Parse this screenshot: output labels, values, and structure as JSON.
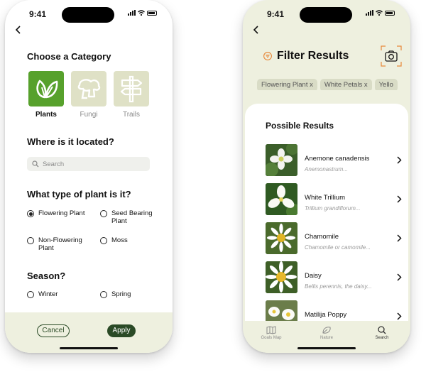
{
  "status": {
    "time": "9:41"
  },
  "screen1": {
    "category_heading": "Choose a Category",
    "categories": [
      {
        "label": "Plants",
        "icon": "leaf-icon",
        "selected": true
      },
      {
        "label": "Fungi",
        "icon": "mushroom-icon",
        "selected": false
      },
      {
        "label": "Trails",
        "icon": "signpost-icon",
        "selected": false
      }
    ],
    "location_heading": "Where is it located?",
    "search_placeholder": "Search",
    "plant_type_heading": "What type of plant is it?",
    "plant_types": [
      {
        "label": "Flowering Plant",
        "selected": true
      },
      {
        "label": "Seed Bearing Plant",
        "selected": false
      },
      {
        "label": "Non-Flowering Plant",
        "selected": false
      },
      {
        "label": "Moss",
        "selected": false
      }
    ],
    "season_heading": "Season?",
    "seasons": [
      {
        "label": "Winter",
        "selected": false
      },
      {
        "label": "Spring",
        "selected": false
      }
    ],
    "cancel_label": "Cancel",
    "apply_label": "Apply"
  },
  "screen2": {
    "title": "Filter Results",
    "chips": [
      "Flowering Plant x",
      "White Petals x",
      "Yello"
    ],
    "results_heading": "Possible Results",
    "results": [
      {
        "name": "Anemone canadensis",
        "scientific": "Anemonastrum..."
      },
      {
        "name": "White Trillium",
        "scientific": "Trillium grandiflorum..."
      },
      {
        "name": "Chamomile",
        "scientific": "Chamomile or camomile..."
      },
      {
        "name": "Daisy",
        "scientific": "Bellis perennis, the daisy..."
      },
      {
        "name": "Matilija Poppy",
        "scientific": ""
      }
    ],
    "tabs": [
      {
        "label": "Goals Map",
        "icon": "map-icon",
        "active": false
      },
      {
        "label": "Nature",
        "icon": "leaf-icon",
        "active": false
      },
      {
        "label": "Search",
        "icon": "search-icon",
        "active": true
      }
    ]
  },
  "colors": {
    "accent": "#57a12c",
    "dark_green": "#2a4a26",
    "cream": "#eef0df",
    "camera_orange": "#e8893a"
  }
}
